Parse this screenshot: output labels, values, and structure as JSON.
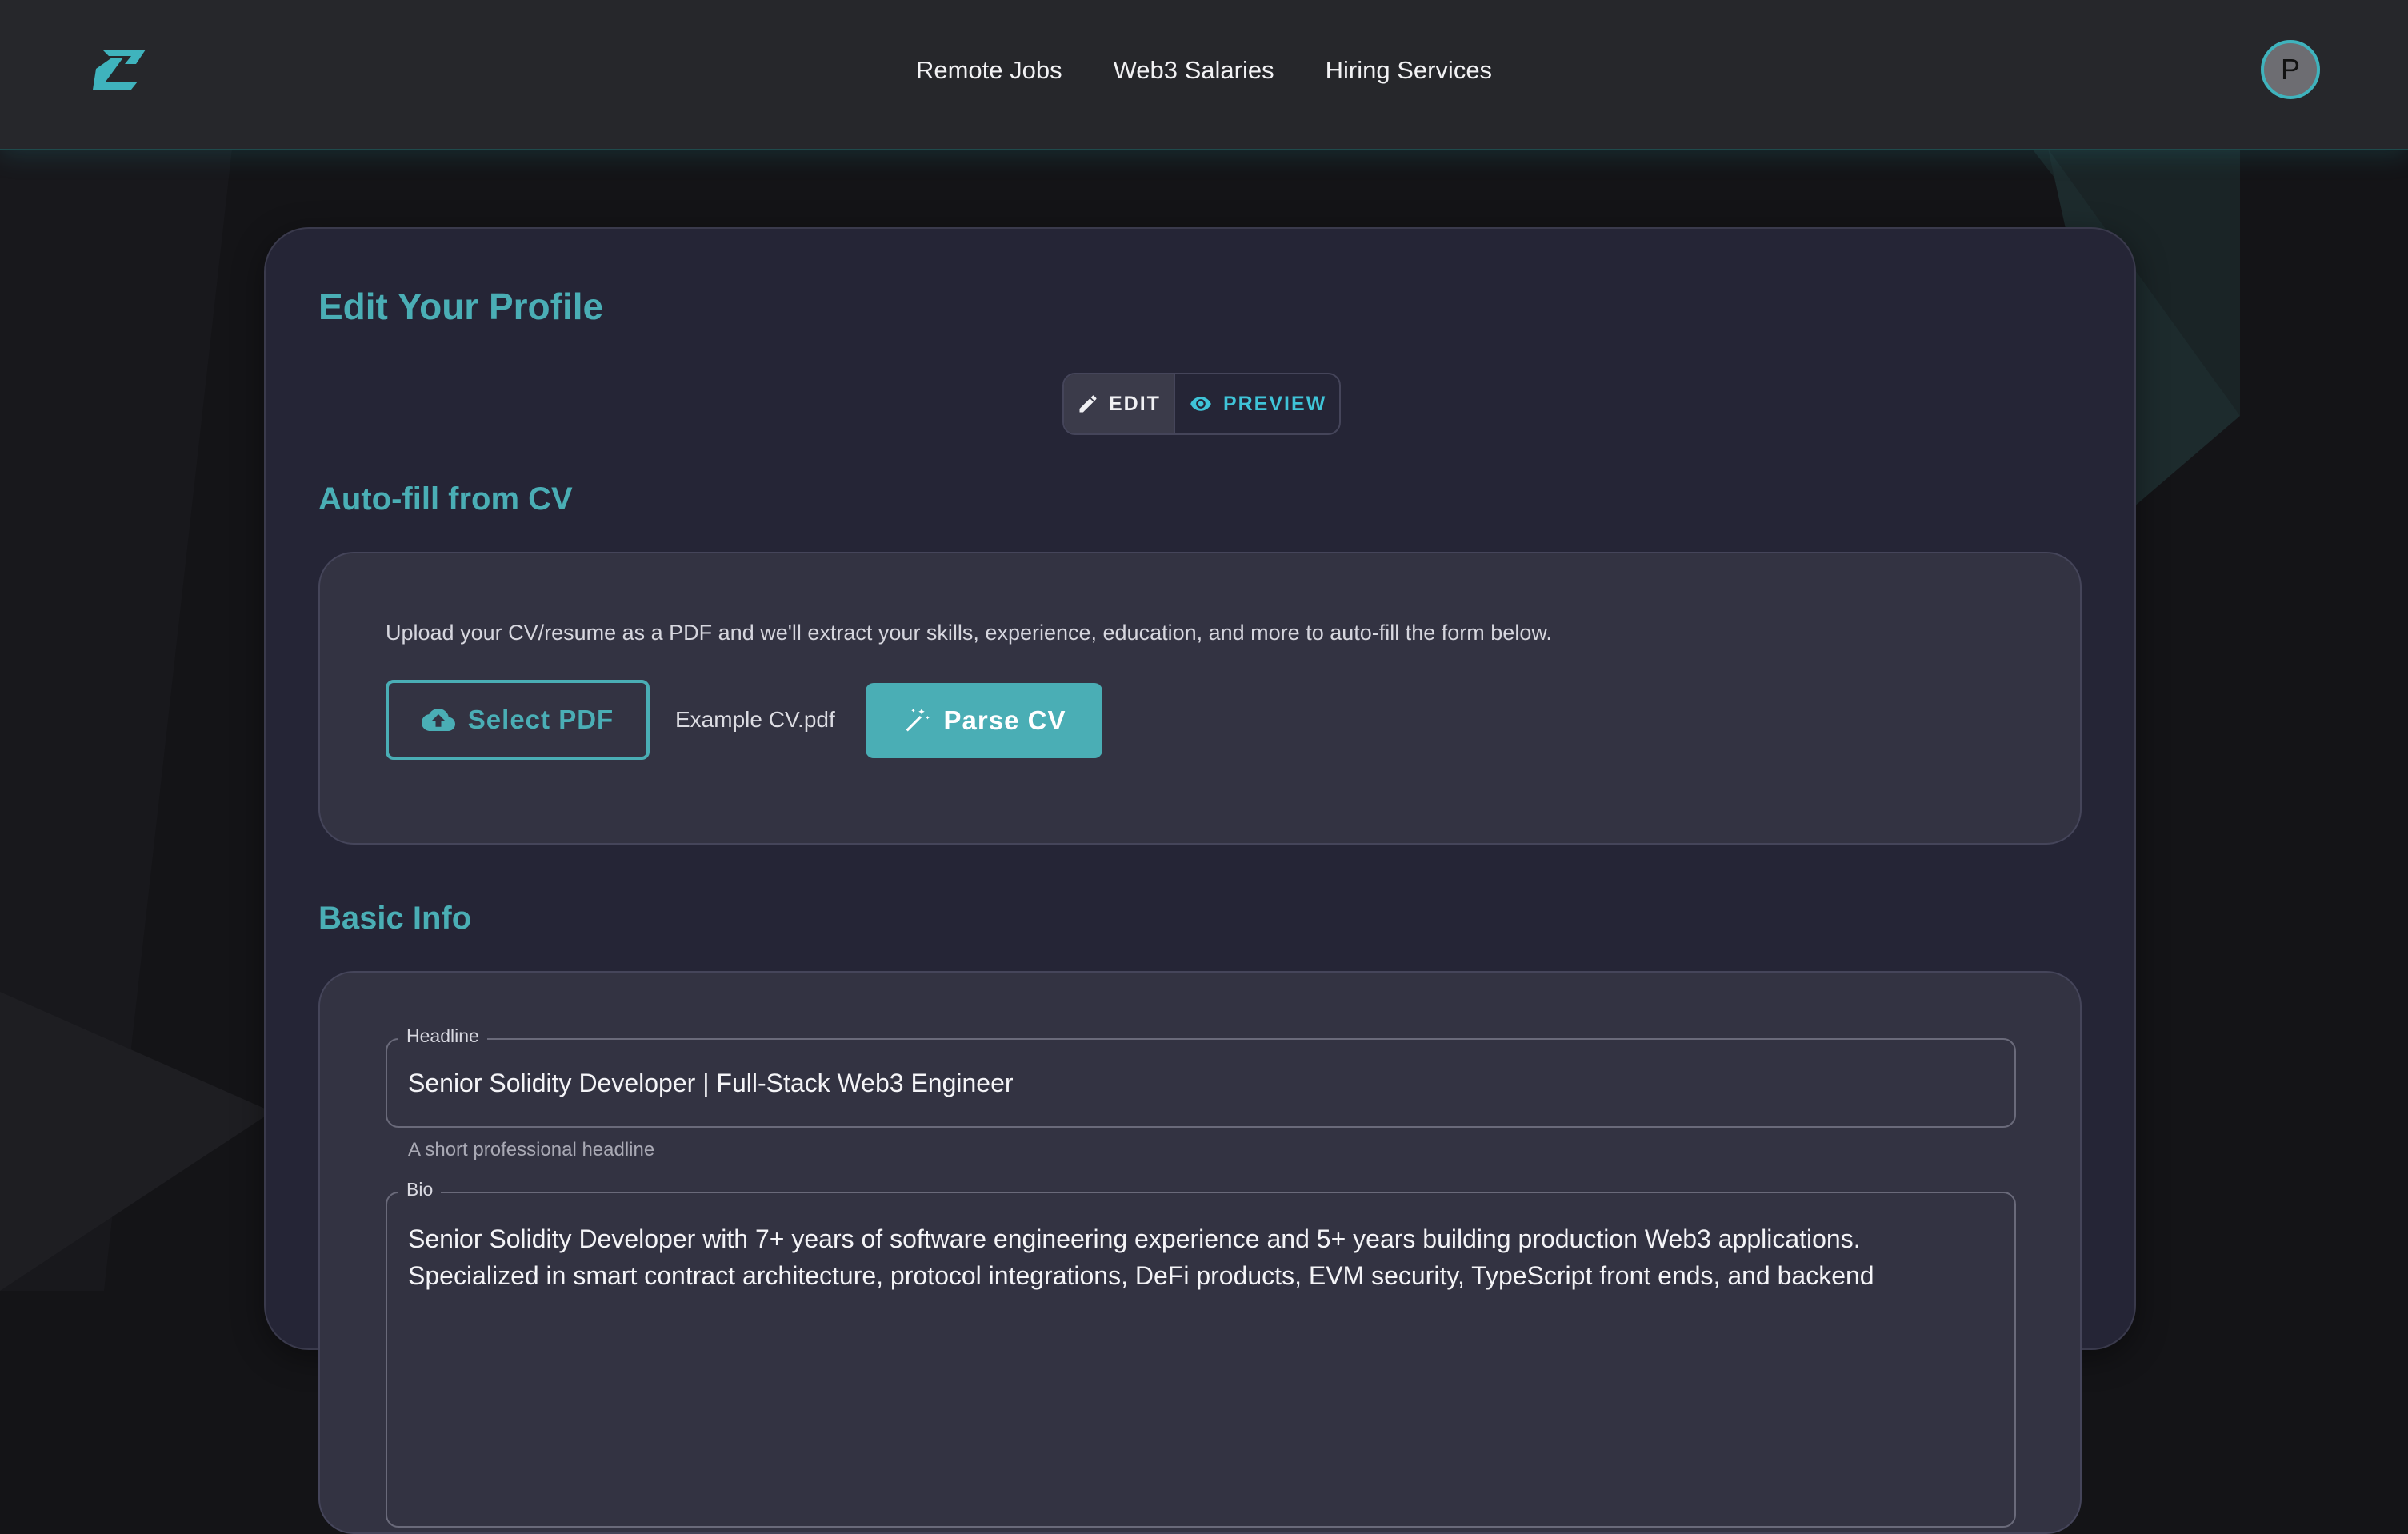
{
  "nav": {
    "links": [
      "Remote Jobs",
      "Web3 Salaries",
      "Hiring Services"
    ],
    "avatar_initial": "P"
  },
  "page": {
    "title": "Edit Your Profile",
    "toggle": {
      "edit": "EDIT",
      "preview": "PREVIEW",
      "active": "edit"
    }
  },
  "autofill": {
    "heading": "Auto-fill from CV",
    "description": "Upload your CV/resume as a PDF and we'll extract your skills, experience, education, and more to auto-fill the form below.",
    "select_label": "Select PDF",
    "file_name": "Example CV.pdf",
    "parse_label": "Parse CV"
  },
  "basic_info": {
    "heading": "Basic Info",
    "headline_label": "Headline",
    "headline_value": "Senior Solidity Developer | Full-Stack Web3 Engineer",
    "headline_helper": "A short professional headline",
    "bio_label": "Bio",
    "bio_line1": "Senior Solidity Developer with 7+ years of software engineering experience and 5+ years building production Web3 applications.",
    "bio_line2": "Specialized in smart contract architecture, protocol integrations, DeFi products, EVM security, TypeScript front ends, and backend"
  },
  "colors": {
    "accent": "#4aaeb5",
    "background": "#141417",
    "card": "#252536",
    "panel": "#333342"
  }
}
